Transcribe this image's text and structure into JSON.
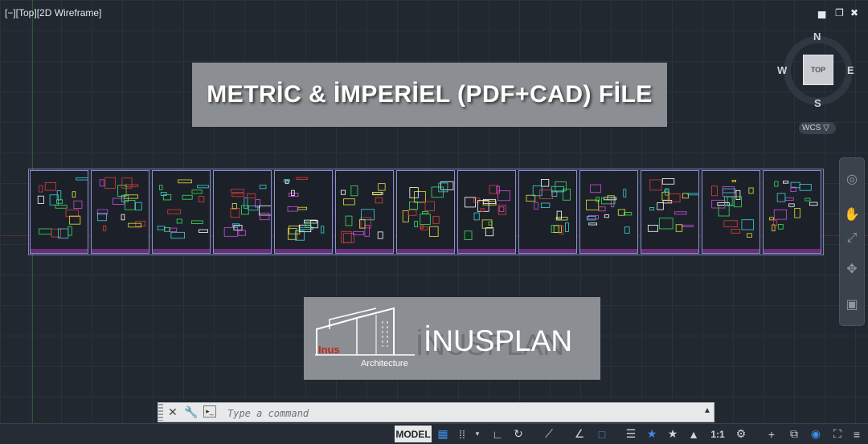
{
  "viewport": {
    "label": "[−][Top][2D Wireframe]"
  },
  "window_controls": {
    "minimize": "▅",
    "restore": "❐",
    "close": "✖"
  },
  "viewcube": {
    "top": "TOP",
    "north": "N",
    "south": "S",
    "east": "E",
    "west": "W",
    "ucs": "WCS ▽"
  },
  "banner": {
    "title": "METRİC & İMPERİEL (PDF+CAD) FİLE"
  },
  "logo": {
    "brand": "İNUSPLAN",
    "mark_name": "Inus",
    "mark_sub": "Architecture"
  },
  "drawing": {
    "sheet_count": 13
  },
  "command_line": {
    "close": "✕",
    "customize": "🔧",
    "prompt_icon": "▸_",
    "placeholder": "Type a command",
    "history": "▲"
  },
  "status_bar": {
    "model": "MODEL",
    "scale": "1:1",
    "items": [
      "grid",
      "snap",
      "ortho",
      "polar",
      "osnap",
      "otrack",
      "lineweight",
      "annotation-scale",
      "settings",
      "add",
      "isolate",
      "fullscreen",
      "customize"
    ]
  },
  "colors": {
    "background": "#212830",
    "banner": "#8b8e92",
    "accent": "#3d8ee6",
    "logo_red": "#c0271d"
  }
}
